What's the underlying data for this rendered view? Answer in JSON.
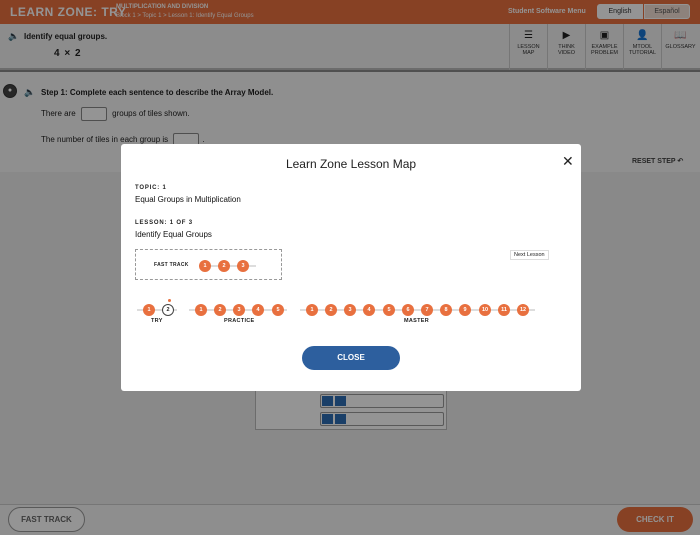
{
  "topbar": {
    "title": "LEARN ZONE: TRY",
    "crumb_line1": "MULTIPLICATION AND DIVISION",
    "crumb_line2": "Block 1 > Topic 1 > Lesson 1: Identify Equal Groups",
    "menu": "Student Software Menu",
    "lang_english": "English",
    "lang_spanish": "Español"
  },
  "task": {
    "prompt": "Identify equal groups.",
    "expression": "4 × 2"
  },
  "tools": [
    {
      "label1": "LESSON",
      "label2": "MAP",
      "icon": "list-icon"
    },
    {
      "label1": "THINK",
      "label2": "VIDEO",
      "icon": "play-icon"
    },
    {
      "label1": "EXAMPLE",
      "label2": "PROBLEM",
      "icon": "board-icon"
    },
    {
      "label1": "MTOOL",
      "label2": "TUTORIAL",
      "icon": "person-icon"
    },
    {
      "label1": "GLOSSARY",
      "label2": "",
      "icon": "book-icon"
    }
  ],
  "step": {
    "title": "Step 1: Complete each sentence to describe the Array Model.",
    "s1_pre": "There are",
    "s1_post": "groups of tiles shown.",
    "s2_pre": "The number of tiles in each group is",
    "s2_post": ".",
    "reset": "RESET STEP"
  },
  "footer": {
    "fast_track": "FAST TRACK",
    "check_it": "CHECK IT"
  },
  "modal": {
    "title": "Learn Zone Lesson Map",
    "topic_label": "TOPIC: 1",
    "topic_name": "Equal Groups in Multiplication",
    "lesson_label": "LESSON: 1 OF 3",
    "lesson_name": "Identify Equal Groups",
    "fast_track_label": "FAST TRACK",
    "fast_track_steps": [
      "1",
      "2",
      "3"
    ],
    "next_lesson": "Next Lesson",
    "try_label": "TRY",
    "try_steps": [
      "1",
      "2"
    ],
    "practice_label": "PRACTICE",
    "practice_steps": [
      "1",
      "2",
      "3",
      "4",
      "5"
    ],
    "master_label": "MASTER",
    "master_steps": [
      "1",
      "2",
      "3",
      "4",
      "5",
      "6",
      "7",
      "8",
      "9",
      "10",
      "11",
      "12"
    ],
    "close_label": "CLOSE"
  },
  "colors": {
    "accent_orange": "#e8703f",
    "primary_blue": "#2d5f9e",
    "tile_blue": "#2d6db3"
  }
}
